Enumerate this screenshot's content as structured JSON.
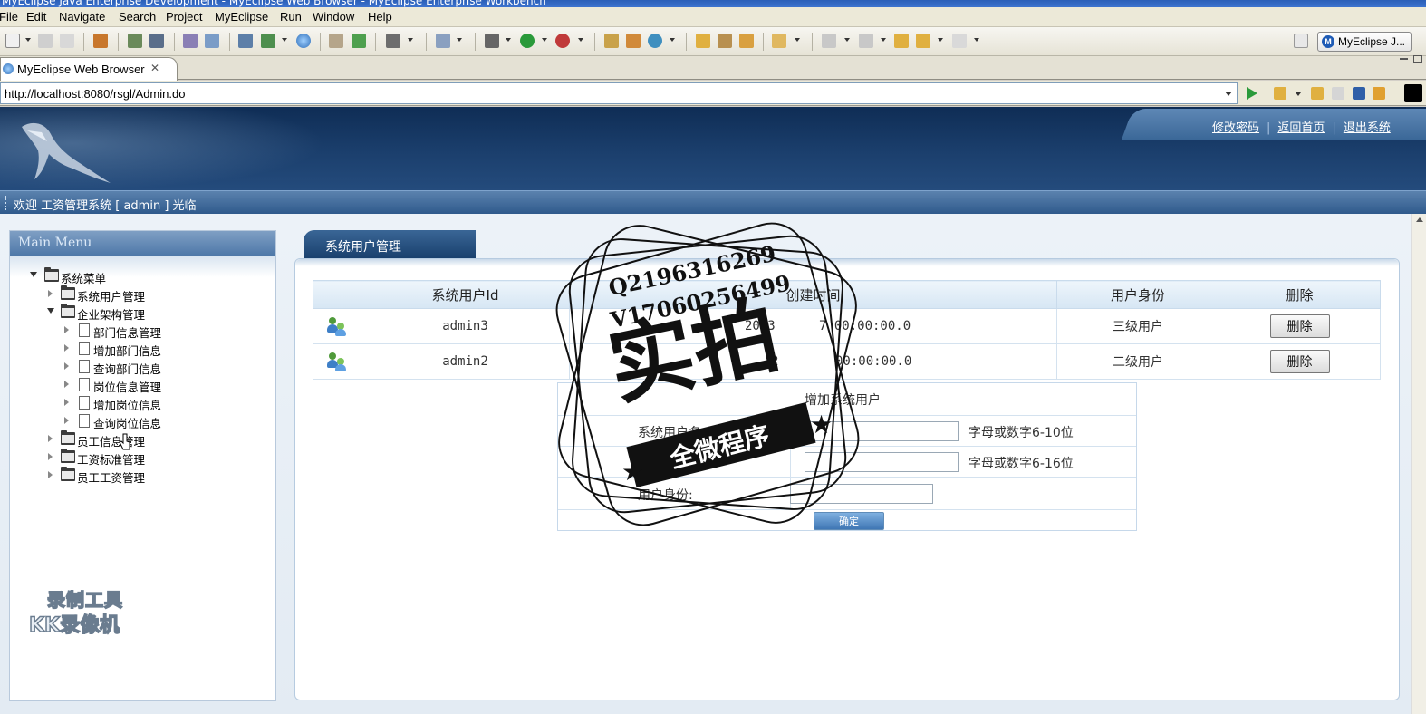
{
  "window": {
    "title": "MyEclipse Java Enterprise Development - MyEclipse Web Browser - MyEclipse Enterprise Workbench"
  },
  "menu": [
    "File",
    "Edit",
    "Navigate",
    "Search",
    "Project",
    "MyEclipse",
    "Run",
    "Window",
    "Help"
  ],
  "perspective": {
    "label": "MyEclipse J...",
    "icon": "myeclipse-perspective-icon"
  },
  "editor_tab": {
    "label": "MyEclipse Web Browser",
    "close": "✕"
  },
  "browser": {
    "url": "http://localhost:8080/rsgl/Admin.do"
  },
  "page": {
    "top_links": [
      "修改密码",
      "返回首页",
      "退出系统"
    ],
    "link_separator": "|",
    "welcome": "欢迎 工资管理系统 [ admin ] 光临",
    "sidebar": {
      "heading": "Main Menu",
      "root": "系统菜单",
      "items": [
        {
          "label": "系统用户管理",
          "level": 1,
          "expanded": false
        },
        {
          "label": "企业架构管理",
          "level": 1,
          "expanded": true
        },
        {
          "label": "部门信息管理",
          "level": 2
        },
        {
          "label": "增加部门信息",
          "level": 2
        },
        {
          "label": "查询部门信息",
          "level": 2
        },
        {
          "label": "岗位信息管理",
          "level": 2
        },
        {
          "label": "增加岗位信息",
          "level": 2
        },
        {
          "label": "查询岗位信息",
          "level": 2
        },
        {
          "label": "员工信息管理",
          "level": 1,
          "expanded": false
        },
        {
          "label": "工资标准管理",
          "level": 1,
          "expanded": false
        },
        {
          "label": "员工工资管理",
          "level": 1,
          "expanded": false
        }
      ]
    },
    "panel_title": "系统用户管理",
    "table": {
      "headers": [
        "",
        "系统用户Id",
        "创建时间",
        "用户身份",
        "删除"
      ],
      "rows": [
        {
          "id": "admin3",
          "created_left": "2013",
          "created_right": "7 00:00:00.0",
          "role": "三级用户",
          "action": "删除"
        },
        {
          "id": "admin2",
          "created_left": "2",
          "created_right": "00:00:00.0",
          "role": "二级用户",
          "action": "删除"
        }
      ]
    },
    "form": {
      "title": "增加系统用户",
      "username_label": "系统用户名:",
      "username_hint": "字母或数字6-10位",
      "password_label": "登录",
      "password_hint": "字母或数字6-16位",
      "role_label": "用户身份:",
      "submit": "确定"
    }
  },
  "overlay_watermarks": {
    "stamp_line1": "Q2196316269",
    "stamp_line2": "V17060256499",
    "stamp_big": "实拍",
    "stamp_ribbon": "全微程序",
    "recorder_line1": "录制工具",
    "recorder_line2": "KK录像机"
  },
  "colors": {
    "banner": "#1b3f6d",
    "header_accent": "#3b6898",
    "panel_border": "#b6cbe0"
  }
}
